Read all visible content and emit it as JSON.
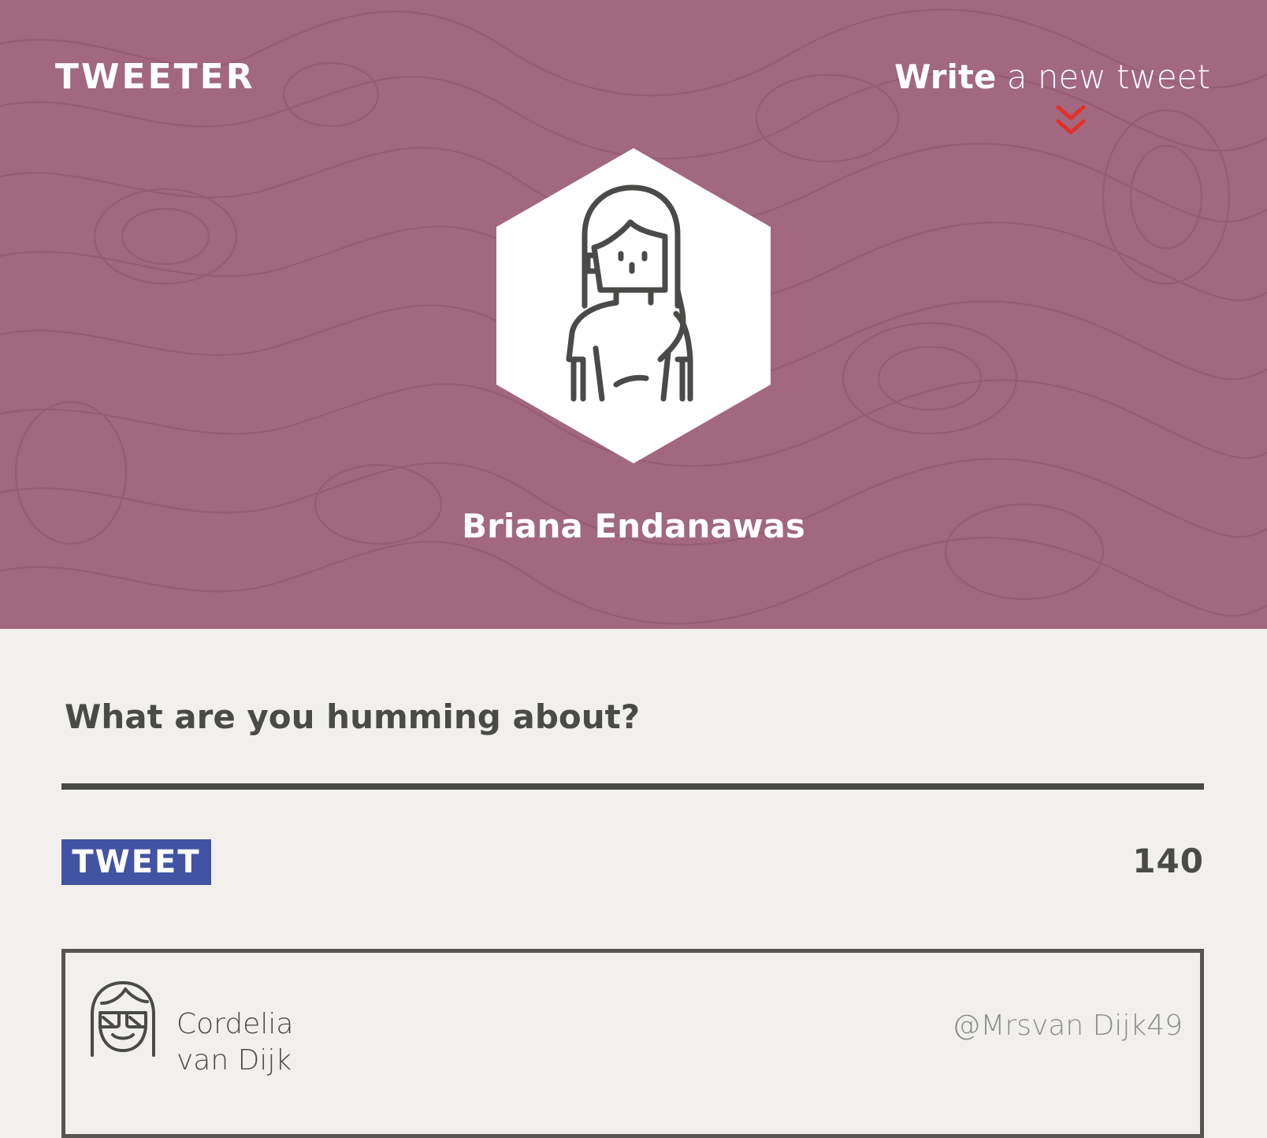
{
  "header": {
    "brand": "TWEETER",
    "write_link": {
      "emphasis": "Write",
      "rest": " a new tweet"
    },
    "chevron_icon": "double-chevron-down",
    "background_color": "#a1687f",
    "accent_color": "#e0312a"
  },
  "profile": {
    "name": "Briana Endanawas",
    "avatar_icon": "woman-avatar"
  },
  "compose": {
    "placeholder": "What are you humming about?",
    "button_label": "TWEET",
    "char_count": "140",
    "button_color": "#4253a4"
  },
  "tweets": [
    {
      "author_first": "Cordelia",
      "author_last": "van Dijk",
      "handle": "@Mrsvan Dijk49",
      "avatar_icon": "sunglasses-avatar"
    }
  ]
}
